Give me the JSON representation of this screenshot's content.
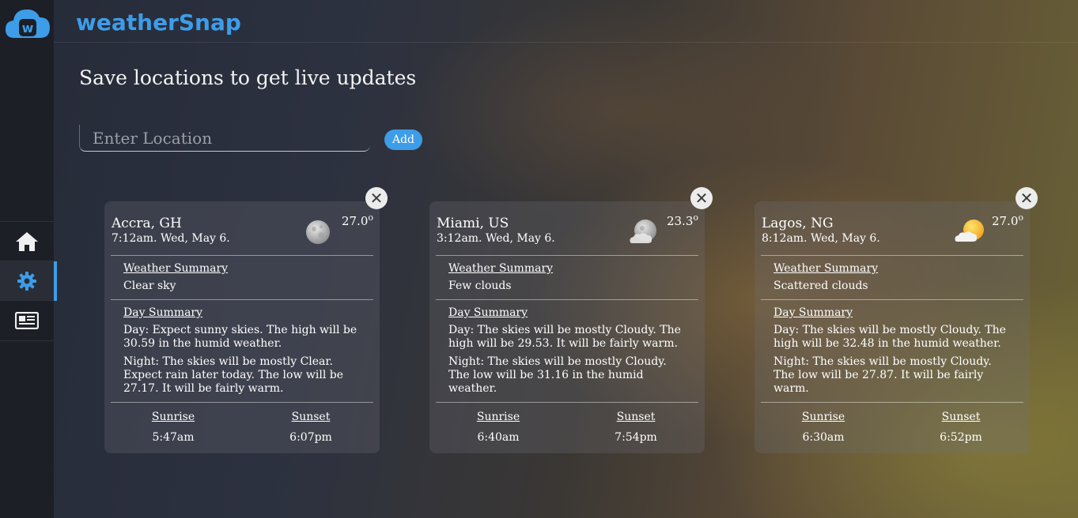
{
  "app": {
    "name": "weatherSnap",
    "badge_letter": "w"
  },
  "header": {
    "headline": "Save locations to get live updates"
  },
  "search": {
    "placeholder": "Enter Location",
    "value": "",
    "add_label": "Add"
  },
  "sidebar": {
    "items": [
      {
        "name": "home",
        "icon": "home-icon",
        "active": false
      },
      {
        "name": "settings",
        "icon": "gear-icon",
        "active": true
      },
      {
        "name": "news",
        "icon": "newspaper-icon",
        "active": false
      }
    ]
  },
  "labels": {
    "weather_summary": "Weather Summary",
    "day_summary": "Day Summary",
    "sunrise": "Sunrise",
    "sunset": "Sunset",
    "degree": "o",
    "close": "✕"
  },
  "cards": [
    {
      "city": "Accra, GH",
      "time": "7:12am. Wed, May 6.",
      "temp": "27.0",
      "icon": "clear-night-moon-icon",
      "weather_summary": "Clear sky",
      "day": "Day: Expect sunny skies. The high will be 30.59 in the humid weather.",
      "night": "Night: The skies will be mostly Clear. Expect rain later today. The low will be 27.17. It will be fairly warm.",
      "sunrise": "5:47am",
      "sunset": "6:07pm"
    },
    {
      "city": "Miami, US",
      "time": "3:12am. Wed, May 6.",
      "temp": "23.3",
      "icon": "cloudy-night-moon-icon",
      "weather_summary": "Few clouds",
      "day": "Day: The skies will be mostly Cloudy. The high will be 29.53. It will be fairly warm.",
      "night": "Night: The skies will be mostly Cloudy. The low will be 31.16 in the humid weather.",
      "sunrise": "6:40am",
      "sunset": "7:54pm"
    },
    {
      "city": "Lagos, NG",
      "time": "8:12am. Wed, May 6.",
      "temp": "27.0",
      "icon": "partly-cloudy-sun-icon",
      "weather_summary": "Scattered clouds",
      "day": "Day: The skies will be mostly Cloudy. The high will be 32.48 in the humid weather.",
      "night": "Night: The skies will be mostly Cloudy. The low will be 27.87. It will be fairly warm.",
      "sunrise": "6:30am",
      "sunset": "6:52pm"
    }
  ],
  "colors": {
    "accent": "#3d9de8",
    "sidebar": "#1c1f26"
  }
}
